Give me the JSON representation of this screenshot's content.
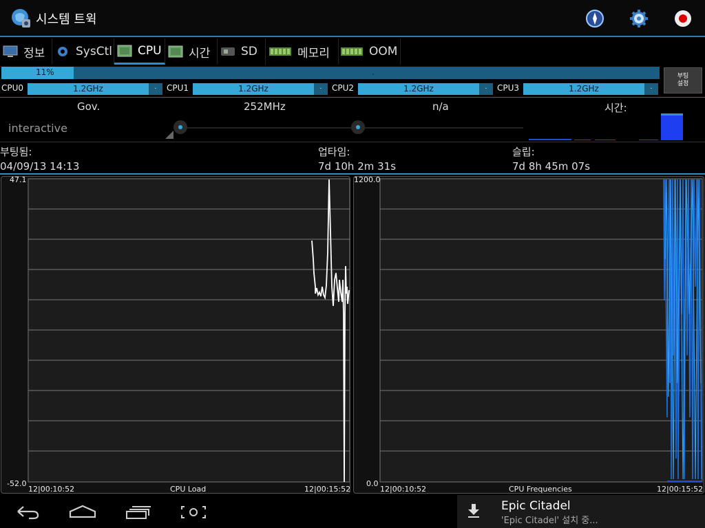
{
  "app": {
    "title": "시스템 트윅"
  },
  "tabs": [
    {
      "label": "정보",
      "icon": "monitor-icon"
    },
    {
      "label": "SysCtl",
      "icon": "gear-icon"
    },
    {
      "label": "CPU",
      "icon": "chip-icon",
      "active": true
    },
    {
      "label": "시간",
      "icon": "chip-icon"
    },
    {
      "label": "SD",
      "icon": "sdcard-icon"
    },
    {
      "label": "메모리",
      "icon": "ram-icon"
    },
    {
      "label": "OOM",
      "icon": "ram-icon"
    }
  ],
  "total": {
    "label": "11%",
    "fraction": 0.11,
    "end": "."
  },
  "boot_button": {
    "line1": "부팅",
    "line2": "설정"
  },
  "cpus": [
    {
      "name": "CPU0",
      "freq": "1.2GHz",
      "end": "."
    },
    {
      "name": "CPU1",
      "freq": "1.2GHz",
      "end": "."
    },
    {
      "name": "CPU2",
      "freq": "1.2GHz",
      "end": "."
    },
    {
      "name": "CPU3",
      "freq": "1.2GHz",
      "end": "."
    }
  ],
  "stats": {
    "gov_label": "Gov.",
    "min_freq": "252MHz",
    "max_freq": "n/a",
    "time_label": "시간:",
    "governor": "interactive"
  },
  "info": {
    "boot_label": "부팅됨:",
    "boot_value": "04/09/13 14:13",
    "uptime_label": "업타임:",
    "uptime_value": "7d 10h 2m 31s",
    "sleep_label": "슬립:",
    "sleep_value": "7d 8h 45m 07s"
  },
  "charts": {
    "load": {
      "ymax": "47.1",
      "ymin": "-52.0",
      "x_start": "12|00:10:52",
      "x_end": "12|00:15:52",
      "title": "CPU Load"
    },
    "freq": {
      "ymax": "1200.0",
      "ymin": "0.0",
      "x_start": "12|00:10:52",
      "x_end": "12|00:15:52",
      "title": "CPU Frequencies"
    }
  },
  "notification": {
    "title": "Epic Citadel",
    "subtitle": "'Epic Citadel' 설치 중..."
  },
  "colors": {
    "accent": "#36a7d9",
    "accent_dark": "#1a5d80",
    "freq_line": "#1e6fe0"
  }
}
